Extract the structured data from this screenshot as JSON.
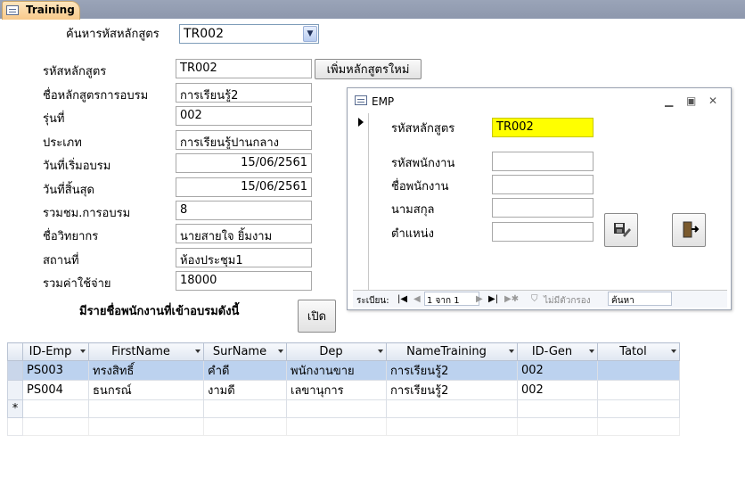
{
  "tab": {
    "label": "Training"
  },
  "search": {
    "label": "ค้นหารหัสหลักสูตร",
    "value": "TR002"
  },
  "form": {
    "fields": [
      {
        "label": "รหัสหลักสูตร",
        "value": "TR002"
      },
      {
        "label": "ชื่อหลักสูตรการอบรม",
        "value": "การเรียนรู้2"
      },
      {
        "label": "รุ่นที่",
        "value": "002"
      },
      {
        "label": "ประเภท",
        "value": "การเรียนรู้ปานกลาง"
      },
      {
        "label": "วันที่เริ่มอบรม",
        "value": "15/06/2561"
      },
      {
        "label": "วันที่สิ้นสุด",
        "value": "15/06/2561"
      },
      {
        "label": "รวมชม.การอบรม",
        "value": "8"
      },
      {
        "label": "ชื่อวิทยากร",
        "value": "นายสายใจ ยิ้มงาม"
      },
      {
        "label": "สถานที่",
        "value": "ห้องประชุม1"
      },
      {
        "label": "รวมค่าใช้จ่าย",
        "value": "18000"
      }
    ],
    "add_course_button": "เพิ่มหลักสูตรใหม่",
    "employee_list_label": "มีรายชื่อพนักงานที่เข้าอบรมดังนี้",
    "open_button": "เปิด"
  },
  "emp": {
    "title": "EMP",
    "fields": [
      {
        "label": "รหัสหลักสูตร",
        "value": "TR002"
      },
      {
        "label": "รหัสพนักงาน",
        "value": ""
      },
      {
        "label": "ชื่อพนักงาน",
        "value": ""
      },
      {
        "label": "นามสกุล",
        "value": ""
      },
      {
        "label": "ตำแหน่ง",
        "value": ""
      }
    ],
    "nav": {
      "record_label": "ระเบียน:",
      "record_value": "1 จาก 1",
      "filter_label": "ไม่มีตัวกรอง",
      "search_label": "ค้นหา"
    },
    "highlight_color": "#ffff00"
  },
  "grid": {
    "columns": [
      "ID-Emp",
      "FirstName",
      "SurName",
      "Dep",
      "NameTraining",
      "ID-Gen",
      "Tatol"
    ],
    "rows": [
      [
        "PS003",
        "ทรงสิทธิ์",
        "คำดี",
        "พนักงานขาย",
        "การเรียนรู้2",
        "002",
        ""
      ],
      [
        "PS004",
        "ธนกรณ์",
        "งามดี",
        "เลขานุการ",
        "การเรียนรู้2",
        "002",
        ""
      ]
    ],
    "new_row_marker": "*"
  }
}
